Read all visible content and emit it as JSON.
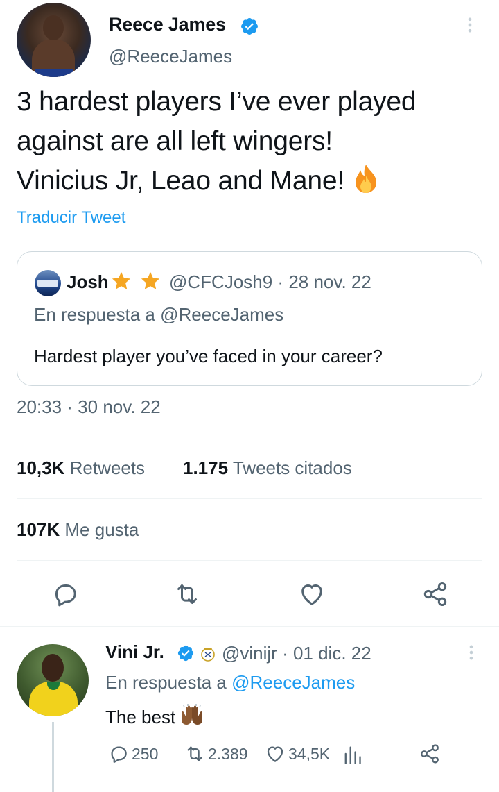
{
  "tweet": {
    "author_name": "Reece James",
    "author_handle": "@ReeceJames",
    "text_lines": [
      "3 hardest players I’ve ever played",
      "against are all left wingers!",
      "Vinicius Jr, Leao and Mane!"
    ],
    "translate_label": "Traducir Tweet",
    "timestamp": "20:33 · 30 nov. 22",
    "stats": {
      "retweets_count": "10,3K",
      "retweets_label": "Retweets",
      "quotes_count": "1.175",
      "quotes_label": "Tweets citados",
      "likes_count": "107K",
      "likes_label": "Me gusta"
    },
    "icons": {
      "verified": "verified-badge-icon",
      "more": "more-vertical-icon",
      "emoji": "fire-emoji-icon",
      "reply": "reply-icon",
      "retweet": "retweet-icon",
      "like": "heart-icon",
      "share": "share-icon"
    }
  },
  "quoted_tweet": {
    "author_name": "Josh",
    "meta": "@CFCJosh9 · 28 nov. 22",
    "reply_to": "En respuesta a @ReeceJames",
    "text": "Hardest player you’ve faced in your career?"
  },
  "reply": {
    "author_name": "Vini Jr.",
    "meta": "@vinijr · 01 dic. 22",
    "reply_prefix": "En respuesta a",
    "reply_mention": "@ReeceJames",
    "text": "The best",
    "reply_count": "250",
    "retweet_count": "2.389",
    "like_count": "34,5K"
  },
  "colors": {
    "accent": "#1d9bf0",
    "secondary_text": "#536471",
    "border": "#cfd9de",
    "star": "#f5a623"
  }
}
